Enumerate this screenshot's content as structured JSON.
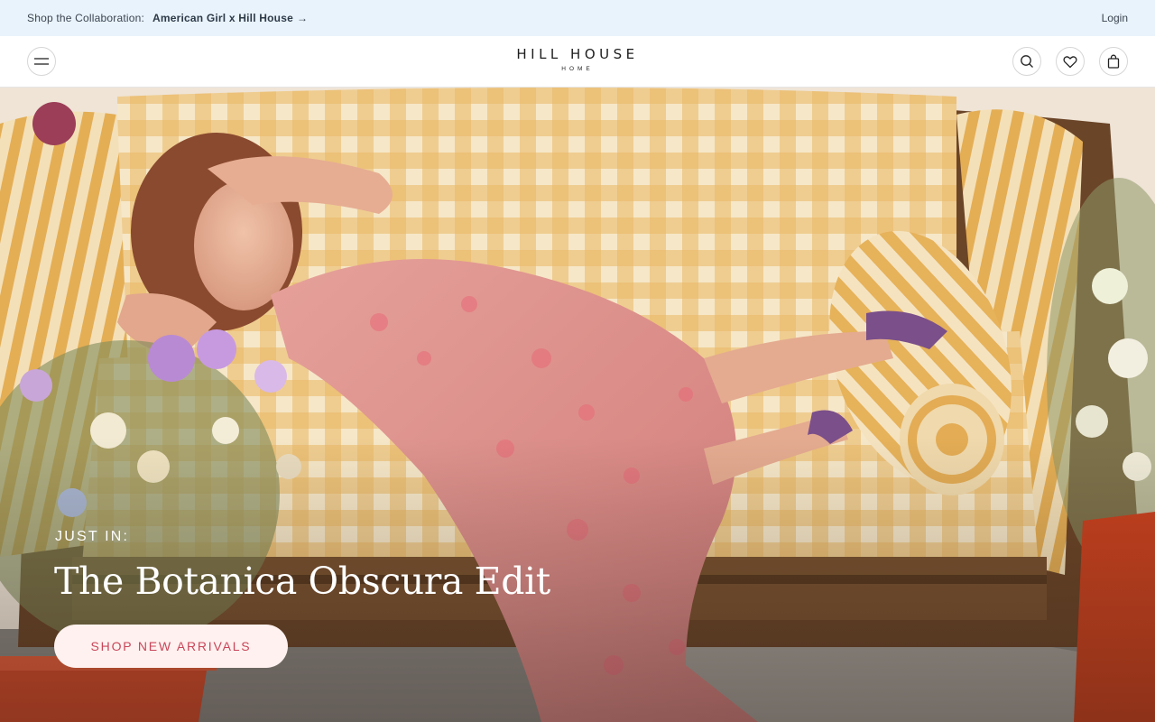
{
  "announcement": {
    "prefix": "Shop the Collaboration:",
    "link_text": "American Girl x Hill House",
    "arrow": "→",
    "login": "Login"
  },
  "header": {
    "logo_main": "HILL HOUSE",
    "logo_sub": "HOME",
    "icons": [
      "menu-icon",
      "search-icon",
      "heart-icon",
      "bag-icon"
    ]
  },
  "hero": {
    "eyebrow": "JUST IN:",
    "title": "The Botanica Obscura Edit",
    "cta": "SHOP NEW ARRIVALS"
  },
  "colors": {
    "announcement_bg": "#e9f3fb",
    "cta_bg": "#fff1ef",
    "cta_text": "#c8465a",
    "gingham": "#e7b75e"
  }
}
